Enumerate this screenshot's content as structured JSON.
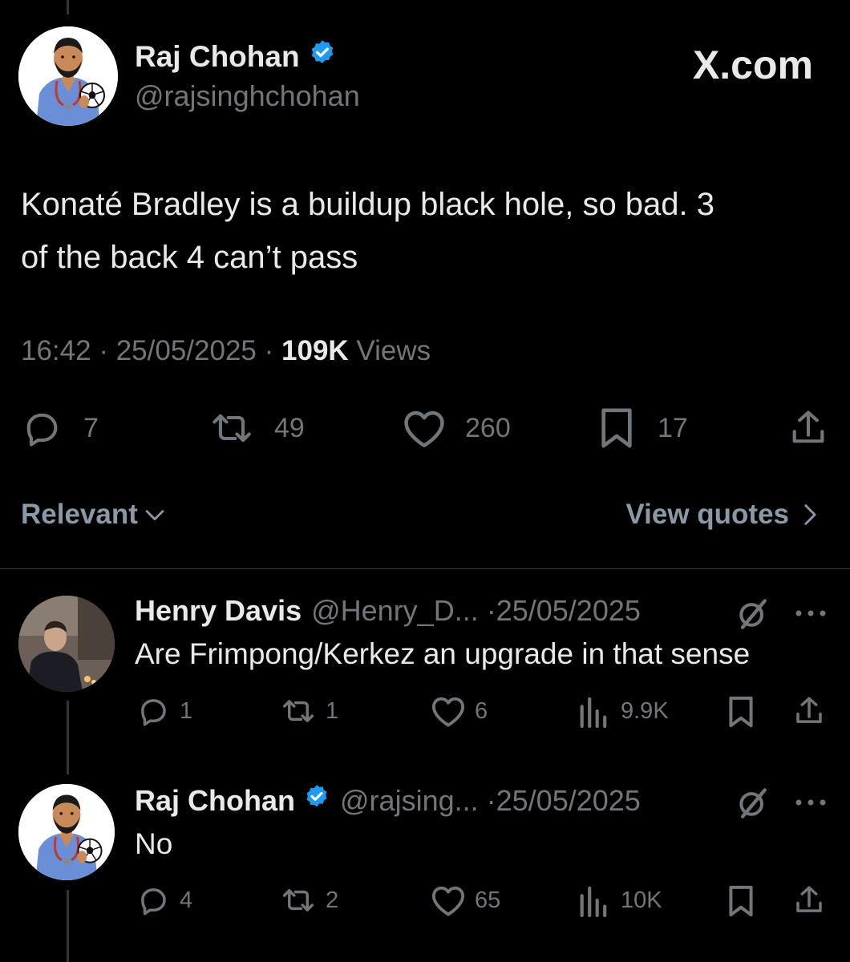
{
  "brand": {
    "site": "X.com"
  },
  "tweet": {
    "author_name": "Raj Chohan",
    "author_handle": "@rajsinghchohan",
    "verified": true,
    "text_line1": "Konaté Bradley is a buildup black hole, so bad. 3",
    "text_line2": "of the back 4 can’t pass",
    "time": "16:42",
    "date": "25/05/2025",
    "views_count": "109K",
    "views_label": "Views",
    "replies": "7",
    "reposts": "49",
    "likes": "260",
    "bookmarks": "17"
  },
  "sort": {
    "relevant_label": "Relevant",
    "view_quotes_label": "View quotes"
  },
  "replies": [
    {
      "author_name": "Henry Davis",
      "author_handle": "@Henry_D...",
      "date": "25/05/2025",
      "text": "Are Frimpong/Kerkez an upgrade in that sense",
      "replies": "1",
      "reposts": "1",
      "likes": "6",
      "views": "9.9K"
    },
    {
      "author_name": "Raj Chohan",
      "author_handle": "@rajsing...",
      "verified": true,
      "date": "25/05/2025",
      "text": "No",
      "replies": "4",
      "reposts": "2",
      "likes": "65",
      "views": "10K"
    }
  ],
  "colors": {
    "background": "#000000",
    "text": "#e7e9ea",
    "secondary": "#71767b",
    "verified": "#1d9bf0",
    "divider": "#2f3336"
  }
}
